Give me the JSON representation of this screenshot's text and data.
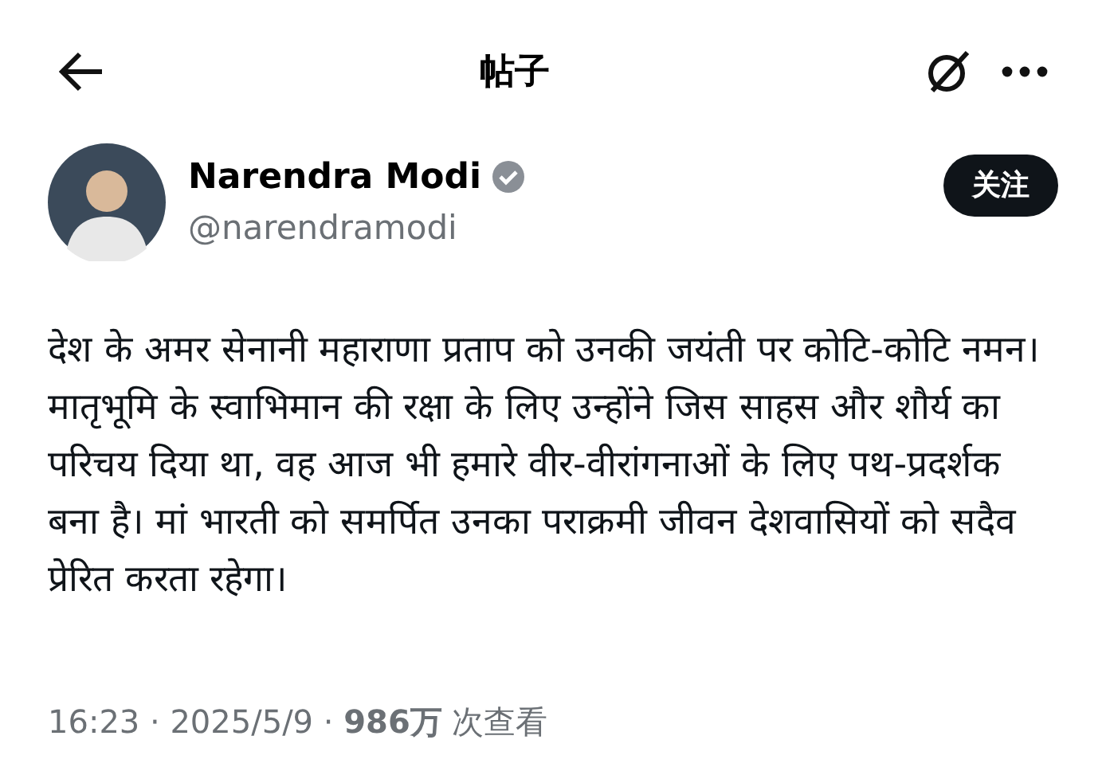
{
  "header": {
    "title": "帖子"
  },
  "author": {
    "name": "Narendra Modi",
    "handle": "@narendramodi",
    "verified": true,
    "follow_label": "关注"
  },
  "post": {
    "text": "देश के अमर सेनानी महाराणा प्रताप को उनकी जयंती पर कोटि-कोटि नमन। मातृभूमि के स्वाभिमान की रक्षा के लिए उन्होंने जिस साहस और शौर्य का परिचय दिया था, वह आज भी हमारे वीर-वीरांगनाओं के लिए पथ-प्रदर्शक बना है। मां भारती को समर्पित उनका पराक्रमी जीवन देशवासियों को सदैव प्रेरित करता रहेगा।",
    "meta": "16:23 · 2025/5/9 · **986万** 次查看"
  }
}
